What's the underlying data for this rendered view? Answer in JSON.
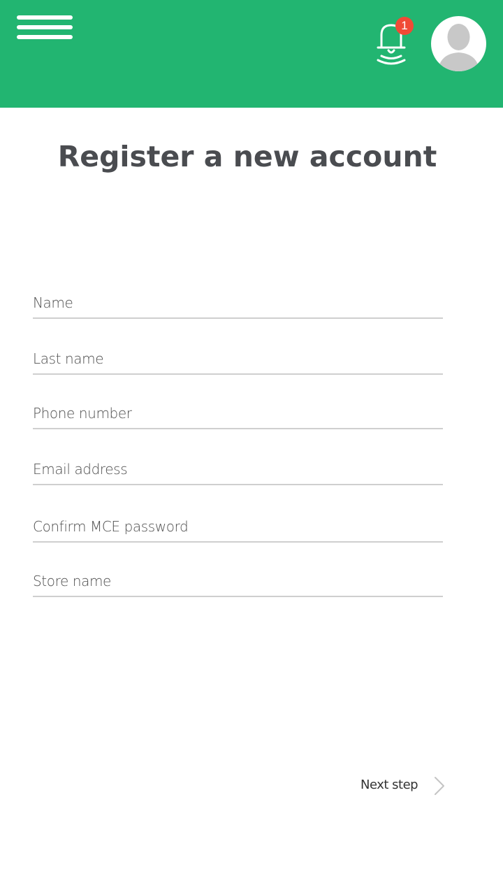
{
  "header": {
    "menu_icon": "hamburger-menu-icon",
    "bell_icon": "notification-bell-icon",
    "notification_count": "1",
    "avatar_icon": "user-avatar-icon",
    "background_color": "#22b571",
    "badge_color": "#f04a36"
  },
  "page": {
    "title": "Register a new account"
  },
  "form": {
    "fields": [
      {
        "label": "Name",
        "value": ""
      },
      {
        "label": "Last name",
        "value": ""
      },
      {
        "label": "Phone number",
        "value": ""
      },
      {
        "label": "Email address",
        "value": ""
      },
      {
        "label": "Confirm MCE password",
        "value": ""
      },
      {
        "label": "Store name",
        "value": ""
      }
    ],
    "next_label": "Next step",
    "next_icon": "chevron-right-icon"
  }
}
